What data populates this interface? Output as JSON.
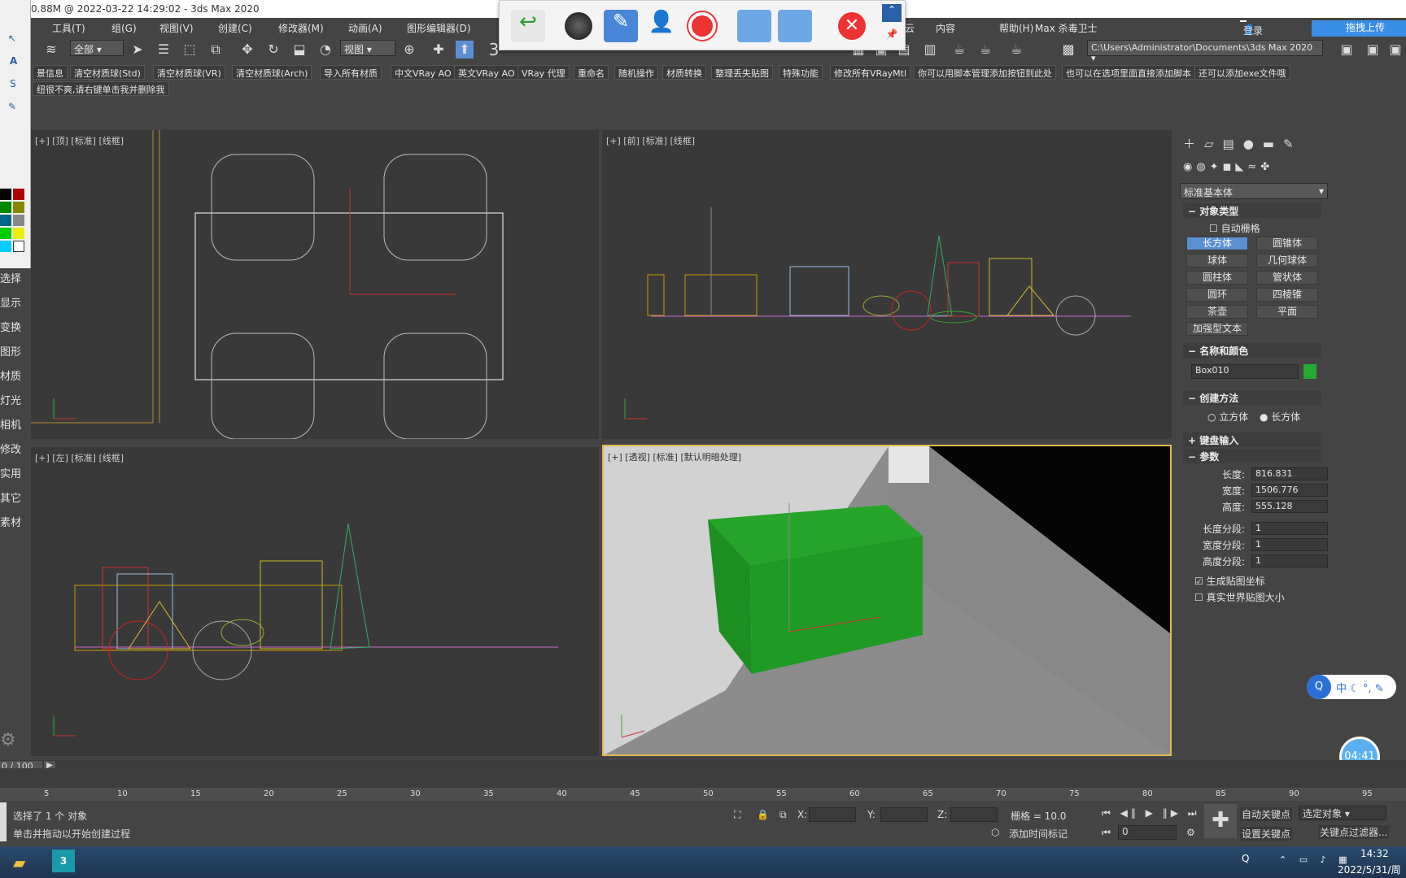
{
  "title": "0.88M @ 2022-03-22 14:29:02 - 3ds Max 2020",
  "menu": [
    "工具(T)",
    "组(G)",
    "视图(V)",
    "创建(C)",
    "修改器(M)",
    "动画(A)",
    "图形编辑器(D)",
    "云",
    "内容",
    "帮助(H)",
    "Max 杀毒卫士"
  ],
  "login": "登录",
  "upload": "拖拽上传",
  "toolbar": {
    "filter": "全部",
    "refsys": "视图",
    "snap": "3",
    "path": "C:\\Users\\Administrator\\Documents\\3ds Max 2020"
  },
  "scripts": [
    "景信息",
    "清空材质球(Std)",
    "清空材质球(VR)",
    "清空材质球(Arch)",
    "导入所有材质",
    "中文VRay AO",
    "英文VRay AO",
    "VRay 代理",
    "重命名",
    "随机操作",
    "材质转换",
    "整理丢失贴图",
    "特殊功能",
    "修改所有VRayMtl",
    "你可以用脚本管理添加按钮到此处",
    "也可以在选项里面直接添加脚本",
    "还可以添加exe文件哦"
  ],
  "scripts_row2": "纽很不爽,请右键单击我并删除我",
  "side": [
    "选择",
    "显示",
    "变换",
    "图形",
    "材质",
    "灯光",
    "相机",
    "修改",
    "实用",
    "其它",
    "素材"
  ],
  "viewports": {
    "top": "[+] [顶] [标准] [线框]",
    "front": "[+] [前] [标准] [线框]",
    "left": "[+] [左] [标准] [线框]",
    "persp": "[+] [透视] [标准] [默认明暗处理]"
  },
  "cmd": {
    "category": "标准基本体",
    "rollout_type": "对象类型",
    "autogrid": "自动栅格",
    "objects": [
      "长方体",
      "圆锥体",
      "球体",
      "几何球体",
      "圆柱体",
      "管状体",
      "圆环",
      "四棱锥",
      "茶壶",
      "平面"
    ],
    "extra": "加强型文本",
    "rollout_name": "名称和颜色",
    "name": "Box010",
    "color": "#22aa33",
    "rollout_method": "创建方法",
    "method": [
      "立方体",
      "长方体"
    ],
    "rollout_key": "键盘输入",
    "rollout_params": "参数",
    "params": [
      {
        "l": "长度:",
        "v": "816.831"
      },
      {
        "l": "宽度:",
        "v": "1506.776"
      },
      {
        "l": "高度:",
        "v": "555.128"
      },
      {
        "l": "长度分段:",
        "v": "1"
      },
      {
        "l": "宽度分段:",
        "v": "1"
      },
      {
        "l": "高度分段:",
        "v": "1"
      }
    ],
    "gen_uv": "生成贴图坐标",
    "real_world": "真实世界贴图大小"
  },
  "frame": "0 / 100",
  "ticks": [
    "5",
    "10",
    "15",
    "20",
    "25",
    "30",
    "35",
    "40",
    "45",
    "50",
    "55",
    "60",
    "65",
    "70",
    "75",
    "80",
    "85",
    "90",
    "95"
  ],
  "status": {
    "selected": "选择了 1 个 对象",
    "hint": "单击并拖动以开始创建过程",
    "x": "X:",
    "y": "Y:",
    "z": "Z:",
    "grid": "栅格 = 10.0",
    "addtag": "添加时间标记",
    "autokey": "自动关键点",
    "setkey": "设置关键点",
    "selobj": "选定对象",
    "keyfilter": "关键点过滤器...",
    "frame": "0"
  },
  "ime": "中",
  "timer": "04:41",
  "clock": {
    "time": "14:32",
    "date": "2022/5/31/周"
  }
}
